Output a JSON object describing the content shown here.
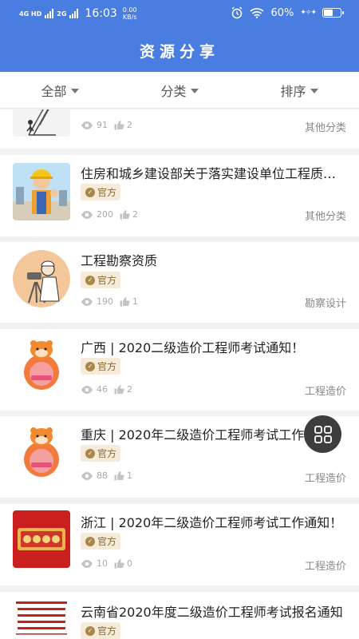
{
  "status": {
    "net1": "4G HD",
    "net2": "2G",
    "time": "16:03",
    "speed_value": "0.00",
    "speed_unit": "KB/s",
    "battery": "60%",
    "battery_level": 0.6
  },
  "header": {
    "title": "资源分享"
  },
  "filters": [
    {
      "label": "全部"
    },
    {
      "label": "分类"
    },
    {
      "label": "排序"
    }
  ],
  "items": [
    {
      "title": "",
      "badge": "官方",
      "views": "91",
      "likes": "2",
      "category": "其他分类",
      "thumb": "construction-site"
    },
    {
      "title": "住房和城乡建设部关于落实建设单位工程质量首要责任的通知",
      "badge": "官方",
      "views": "200",
      "likes": "2",
      "category": "其他分类",
      "thumb": "worker-thumbs-up"
    },
    {
      "title": "工程勘察资质",
      "badge": "官方",
      "views": "190",
      "likes": "1",
      "category": "勘察设计",
      "thumb": "surveyor"
    },
    {
      "title": "广西 | 2020二级造价工程师考试通知！",
      "badge": "官方",
      "views": "46",
      "likes": "2",
      "category": "工程造价",
      "thumb": "tiger-mascot"
    },
    {
      "title": "重庆 | 2020年二级造价工程师考试工作通知！",
      "badge": "官方",
      "views": "88",
      "likes": "1",
      "category": "工程造价",
      "thumb": "tiger-mascot"
    },
    {
      "title": "浙江 | 2020年二级造价工程师考试工作通知！",
      "badge": "官方",
      "views": "10",
      "likes": "0",
      "category": "工程造价",
      "thumb": "red-banner"
    },
    {
      "title": "云南省2020年度二级造价工程师考试报名通知",
      "badge": "官方",
      "views": "",
      "likes": "",
      "category": "",
      "thumb": "official-document"
    }
  ]
}
